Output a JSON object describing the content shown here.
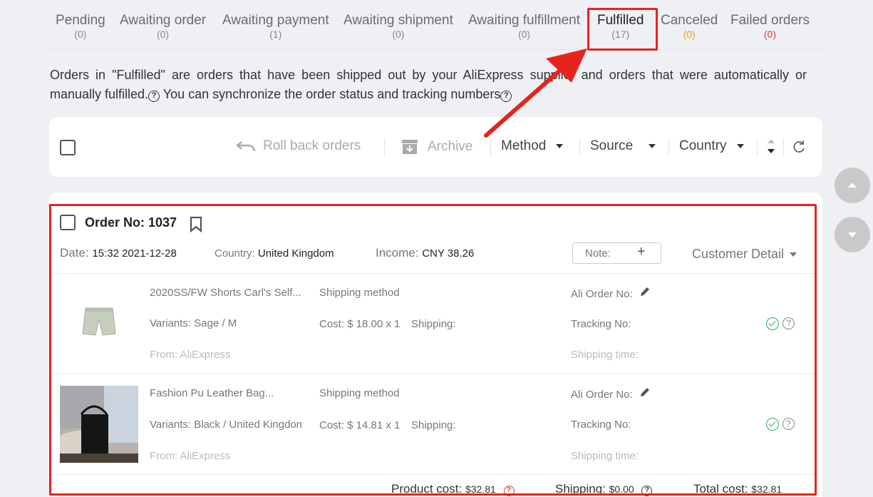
{
  "tabs": [
    {
      "label": "Pending",
      "count": "(0)"
    },
    {
      "label": "Awaiting order",
      "count": "(0)"
    },
    {
      "label": "Awaiting payment",
      "count": "(1)"
    },
    {
      "label": "Awaiting shipment",
      "count": "(0)"
    },
    {
      "label": "Awaiting fulfillment",
      "count": "(0)"
    },
    {
      "label": "Fulfilled",
      "count": "(17)"
    },
    {
      "label": "Canceled",
      "count": "(0)"
    },
    {
      "label": "Failed orders",
      "count": "(0)"
    }
  ],
  "description": {
    "line1": "Orders in \"Fulfilled\" are orders that have been shipped out by your AliExpress supplier and orders that were automatically or manually fulfilled.",
    "line2": "You can synchronize the order status and tracking numbers"
  },
  "toolbar": {
    "rollback": "Roll back orders",
    "archive": "Archive",
    "method": "Method",
    "source": "Source",
    "country": "Country"
  },
  "order": {
    "number": "Order No: 1037",
    "date_label": "Date:",
    "date_value": "15:32 2021-12-28",
    "country_label": "Country:",
    "country_value": "United Kingdom",
    "income_label": "Income:",
    "income_value": "CNY 38.26",
    "note_label": "Note:",
    "customer_detail": "Customer Detail",
    "items": [
      {
        "title": "2020SS/FW Shorts Carl's Self...",
        "variants": "Variants: Sage / M",
        "from": "From: AliExpress",
        "shipping_method": "Shipping method",
        "cost": "Cost: $ 18.00 x 1",
        "shipping": "Shipping:",
        "ali_order": "Ali Order No:",
        "tracking": "Tracking No:",
        "shipping_time": "Shipping time:"
      },
      {
        "title": "Fashion Pu Leather Bag...",
        "variants": "Variants: Black / United Kingdon",
        "from": "From: AliExpress",
        "shipping_method": "Shipping method",
        "cost": "Cost: $ 14.81 x 1",
        "shipping": "Shipping:",
        "ali_order": "Ali Order No:",
        "tracking": "Tracking No:",
        "shipping_time": "Shipping time:"
      }
    ],
    "footer": {
      "product_cost_label": "Product cost:",
      "product_cost_value": "$32.81",
      "shipping_label": "Shipping:",
      "shipping_value": "$0.00",
      "total_label": "Total cost:",
      "total_value": "$32.81"
    }
  },
  "colors": {
    "annotation": "#e8231d",
    "success": "#27ae60",
    "warning": "#f39c12",
    "danger": "#e53935"
  }
}
